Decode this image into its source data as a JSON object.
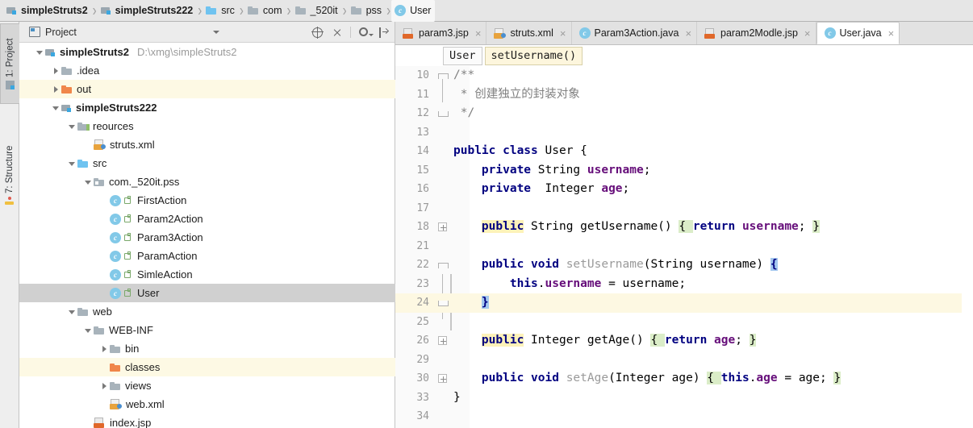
{
  "breadcrumb": {
    "items": [
      {
        "label": "simpleStruts2",
        "icon": "module-icon",
        "bold": true
      },
      {
        "label": "simpleStruts222",
        "icon": "module-icon",
        "bold": true
      },
      {
        "label": "src",
        "icon": "folder-blue-icon",
        "bold": false
      },
      {
        "label": "com",
        "icon": "folder-icon",
        "bold": false
      },
      {
        "label": "_520it",
        "icon": "folder-icon",
        "bold": false
      },
      {
        "label": "pss",
        "icon": "folder-icon",
        "bold": false
      },
      {
        "label": "User",
        "icon": "java-class-icon",
        "bold": false
      }
    ],
    "separator": "›"
  },
  "toolstrip": {
    "project_tab": "1: Project",
    "structure_tab": "7: Structure"
  },
  "project_panel": {
    "title": "Project",
    "tools": [
      "locate-target-icon",
      "collapse-all-icon",
      "gear-icon",
      "hide-panel-icon"
    ],
    "tree": [
      {
        "depth": 0,
        "arrow": "down",
        "icon": "module-icon",
        "label": "simpleStruts2",
        "bold": true,
        "path": "D:\\xmg\\simpleStruts2",
        "state": "normal"
      },
      {
        "depth": 1,
        "arrow": "right",
        "icon": "folder-icon",
        "label": ".idea",
        "bold": false,
        "path": "",
        "state": "normal"
      },
      {
        "depth": 1,
        "arrow": "right",
        "icon": "folder-orange-icon",
        "label": "out",
        "bold": false,
        "path": "",
        "state": "yellow"
      },
      {
        "depth": 1,
        "arrow": "down",
        "icon": "module-icon",
        "label": "simpleStruts222",
        "bold": true,
        "path": "",
        "state": "normal"
      },
      {
        "depth": 2,
        "arrow": "down",
        "icon": "folder-resources-icon",
        "label": "reources",
        "bold": false,
        "path": "",
        "state": "normal"
      },
      {
        "depth": 3,
        "arrow": "none",
        "icon": "xml-file-icon",
        "label": "struts.xml",
        "bold": false,
        "path": "",
        "state": "normal"
      },
      {
        "depth": 2,
        "arrow": "down",
        "icon": "folder-blue-icon",
        "label": "src",
        "bold": false,
        "path": "",
        "state": "normal"
      },
      {
        "depth": 3,
        "arrow": "down",
        "icon": "package-icon",
        "label": "com._520it.pss",
        "bold": false,
        "path": "",
        "state": "normal"
      },
      {
        "depth": 4,
        "arrow": "none",
        "icon": "java-class-icon",
        "label": "FirstAction",
        "bold": false,
        "path": "",
        "state": "normal"
      },
      {
        "depth": 4,
        "arrow": "none",
        "icon": "java-class-icon",
        "label": "Param2Action",
        "bold": false,
        "path": "",
        "state": "normal"
      },
      {
        "depth": 4,
        "arrow": "none",
        "icon": "java-class-icon",
        "label": "Param3Action",
        "bold": false,
        "path": "",
        "state": "normal"
      },
      {
        "depth": 4,
        "arrow": "none",
        "icon": "java-class-icon",
        "label": "ParamAction",
        "bold": false,
        "path": "",
        "state": "normal"
      },
      {
        "depth": 4,
        "arrow": "none",
        "icon": "java-class-icon",
        "label": "SimleAction",
        "bold": false,
        "path": "",
        "state": "normal"
      },
      {
        "depth": 4,
        "arrow": "none",
        "icon": "java-class-icon",
        "label": "User",
        "bold": false,
        "path": "",
        "state": "selected"
      },
      {
        "depth": 2,
        "arrow": "down",
        "icon": "folder-icon",
        "label": "web",
        "bold": false,
        "path": "",
        "state": "normal"
      },
      {
        "depth": 3,
        "arrow": "down",
        "icon": "folder-icon",
        "label": "WEB-INF",
        "bold": false,
        "path": "",
        "state": "normal"
      },
      {
        "depth": 4,
        "arrow": "right",
        "icon": "folder-icon",
        "label": "bin",
        "bold": false,
        "path": "",
        "state": "normal"
      },
      {
        "depth": 4,
        "arrow": "none",
        "icon": "folder-orange-icon",
        "label": "classes",
        "bold": false,
        "path": "",
        "state": "yellow"
      },
      {
        "depth": 4,
        "arrow": "right",
        "icon": "folder-icon",
        "label": "views",
        "bold": false,
        "path": "",
        "state": "normal"
      },
      {
        "depth": 4,
        "arrow": "none",
        "icon": "xml-file-icon",
        "label": "web.xml",
        "bold": false,
        "path": "",
        "state": "normal"
      },
      {
        "depth": 3,
        "arrow": "none",
        "icon": "jsp-file-icon",
        "label": "index.jsp",
        "bold": false,
        "path": "",
        "state": "normal"
      }
    ]
  },
  "editor_tabs": [
    {
      "label": "param3.jsp",
      "icon": "jsp-file-icon",
      "active": false,
      "close": "×"
    },
    {
      "label": "struts.xml",
      "icon": "xml-file-icon",
      "active": false,
      "close": "×"
    },
    {
      "label": "Param3Action.java",
      "icon": "java-class-icon",
      "active": false,
      "close": "×"
    },
    {
      "label": "param2Modle.jsp",
      "icon": "jsp-file-icon",
      "active": false,
      "close": "×"
    },
    {
      "label": "User.java",
      "icon": "java-class-icon",
      "active": true,
      "close": "×"
    }
  ],
  "editor_breadcrumb": [
    {
      "label": "User",
      "highlight": false
    },
    {
      "label": "setUsername()",
      "highlight": true
    }
  ],
  "code": {
    "lines": [
      {
        "num": "10",
        "fold": "tip",
        "current": false,
        "tokens": [
          {
            "t": "/**",
            "c": "cmt"
          }
        ]
      },
      {
        "num": "11",
        "fold": "",
        "current": false,
        "tokens": [
          {
            "t": " * 创建独立的封装对象",
            "c": "cmt"
          }
        ]
      },
      {
        "num": "12",
        "fold": "tipend",
        "current": false,
        "tokens": [
          {
            "t": " */",
            "c": "cmt"
          }
        ]
      },
      {
        "num": "13",
        "fold": "",
        "current": false,
        "tokens": []
      },
      {
        "num": "14",
        "fold": "",
        "current": false,
        "tokens": [
          {
            "t": "public class ",
            "c": "kw"
          },
          {
            "t": "User {",
            "c": "plain"
          }
        ]
      },
      {
        "num": "15",
        "fold": "",
        "current": false,
        "tokens": [
          {
            "t": "    private ",
            "c": "kw"
          },
          {
            "t": "String ",
            "c": "plain"
          },
          {
            "t": "username",
            "c": "fld"
          },
          {
            "t": ";",
            "c": "plain"
          }
        ]
      },
      {
        "num": "16",
        "fold": "",
        "current": false,
        "tokens": [
          {
            "t": "    private ",
            "c": "kw"
          },
          {
            "t": " Integer ",
            "c": "plain"
          },
          {
            "t": "age",
            "c": "fld"
          },
          {
            "t": ";",
            "c": "plain"
          }
        ]
      },
      {
        "num": "17",
        "fold": "",
        "current": false,
        "tokens": []
      },
      {
        "num": "18",
        "fold": "plus",
        "current": false,
        "tokens": [
          {
            "t": "    ",
            "c": "plain"
          },
          {
            "t": "public",
            "c": "kwh"
          },
          {
            "t": " String getUsername() ",
            "c": "plain"
          },
          {
            "t": "{ ",
            "c": "brc"
          },
          {
            "t": "return ",
            "c": "kw"
          },
          {
            "t": "username",
            "c": "fld"
          },
          {
            "t": "; ",
            "c": "plain"
          },
          {
            "t": "}",
            "c": "brc"
          }
        ]
      },
      {
        "num": "21",
        "fold": "",
        "current": false,
        "tokens": []
      },
      {
        "num": "22",
        "fold": "tip",
        "current": false,
        "tokens": [
          {
            "t": "    ",
            "c": "plain"
          },
          {
            "t": "public void ",
            "c": "kw"
          },
          {
            "t": "setUsername",
            "c": "mth"
          },
          {
            "t": "(String username) ",
            "c": "plain"
          },
          {
            "t": "{",
            "c": "brsel"
          }
        ]
      },
      {
        "num": "23",
        "fold": "",
        "current": false,
        "tokens": [
          {
            "t": "        ",
            "c": "plain"
          },
          {
            "t": "this",
            "c": "kw"
          },
          {
            "t": ".",
            "c": "plain"
          },
          {
            "t": "username",
            "c": "fld"
          },
          {
            "t": " = username;",
            "c": "plain"
          }
        ]
      },
      {
        "num": "24",
        "fold": "tipend",
        "current": true,
        "tokens": [
          {
            "t": "    ",
            "c": "plain"
          },
          {
            "t": "}",
            "c": "brsel"
          }
        ]
      },
      {
        "num": "25",
        "fold": "",
        "current": false,
        "tokens": []
      },
      {
        "num": "26",
        "fold": "plus",
        "current": false,
        "tokens": [
          {
            "t": "    ",
            "c": "plain"
          },
          {
            "t": "public",
            "c": "kwh"
          },
          {
            "t": " Integer getAge() ",
            "c": "plain"
          },
          {
            "t": "{ ",
            "c": "brc"
          },
          {
            "t": "return ",
            "c": "kw"
          },
          {
            "t": "age",
            "c": "fld"
          },
          {
            "t": "; ",
            "c": "plain"
          },
          {
            "t": "}",
            "c": "brc"
          }
        ]
      },
      {
        "num": "29",
        "fold": "",
        "current": false,
        "tokens": []
      },
      {
        "num": "30",
        "fold": "plus",
        "current": false,
        "tokens": [
          {
            "t": "    ",
            "c": "plain"
          },
          {
            "t": "public void ",
            "c": "kw"
          },
          {
            "t": "setAge",
            "c": "mth"
          },
          {
            "t": "(Integer age) ",
            "c": "plain"
          },
          {
            "t": "{ ",
            "c": "brc"
          },
          {
            "t": "this",
            "c": "kw"
          },
          {
            "t": ".",
            "c": "plain"
          },
          {
            "t": "age",
            "c": "fld"
          },
          {
            "t": " = age; ",
            "c": "plain"
          },
          {
            "t": "}",
            "c": "brc"
          }
        ]
      },
      {
        "num": "33",
        "fold": "",
        "current": false,
        "tokens": [
          {
            "t": "}",
            "c": "plain"
          }
        ]
      },
      {
        "num": "34",
        "fold": "",
        "current": false,
        "tokens": []
      }
    ]
  },
  "colors": {
    "keyword": "#000080",
    "field": "#660e7a",
    "comment": "#808080",
    "method": "#9a9a9a",
    "current_line": "#fdf8e2",
    "selection": "#a5c8ef",
    "brace_match": "#dbedc8",
    "search_highlight": "#fdf2b9",
    "tree_selected": "#d0d0d0",
    "tree_excluded": "#fdf9e4",
    "accent_blue": "#3ba7e0"
  }
}
